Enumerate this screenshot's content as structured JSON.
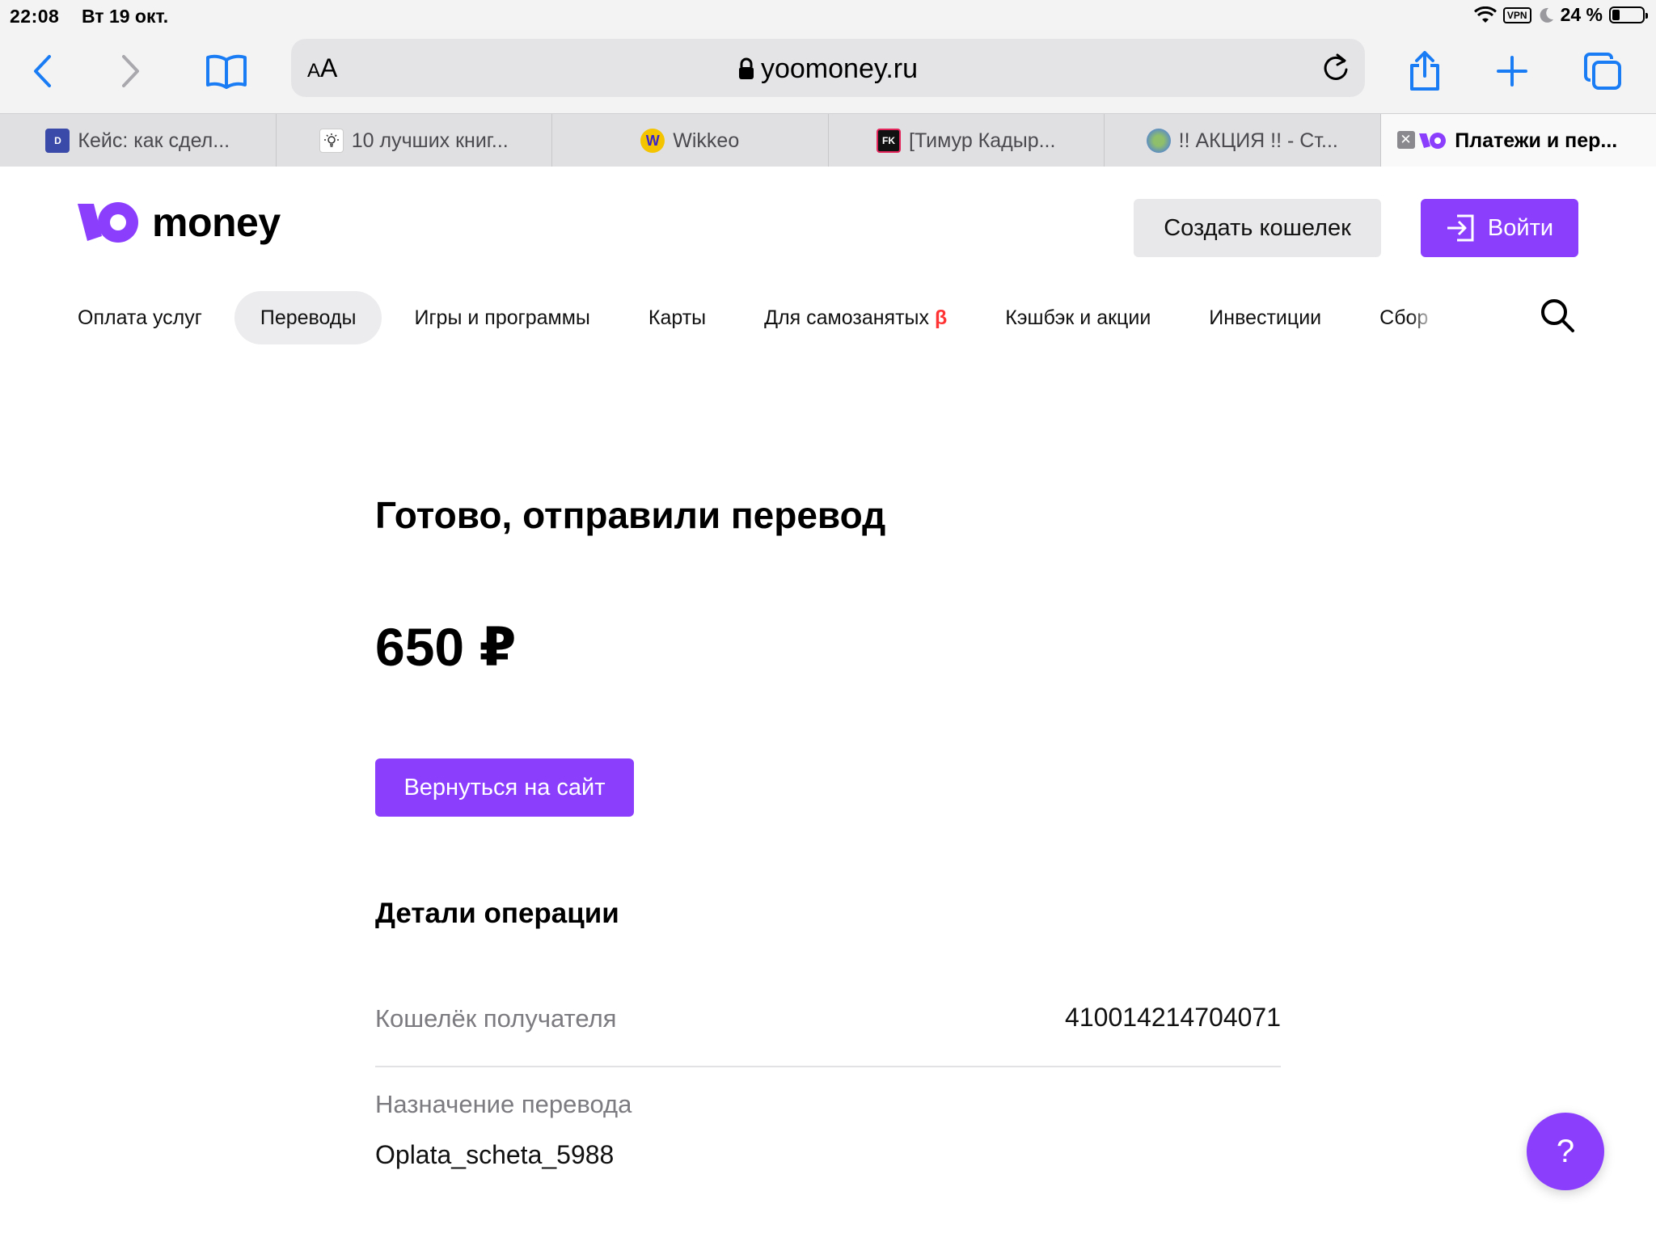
{
  "status_bar": {
    "time": "22:08",
    "date": "Вт 19 окт.",
    "vpn": "VPN",
    "battery_pct": "24 %",
    "battery_level": 0.24
  },
  "browser": {
    "url": "yoomoney.ru",
    "text_size_label": "AA",
    "icons": [
      "back-chevron-icon",
      "forward-chevron-icon",
      "bookmarks-book-icon",
      "lock-icon",
      "reload-icon",
      "share-icon",
      "plus-icon",
      "tabs-overview-icon"
    ],
    "tabs": [
      {
        "label": "Кейс: как сдел...",
        "favicon": "D"
      },
      {
        "label": "10 лучших книг...",
        "favicon": "lightbulb"
      },
      {
        "label": "Wikkeo",
        "favicon": "W"
      },
      {
        "label": "[Тимур Кадыр...",
        "favicon": "FK"
      },
      {
        "label": "!! АКЦИЯ !! - Ст...",
        "favicon": "globe"
      },
      {
        "label": "Платежи и пер...",
        "favicon": "yoomoney",
        "active": true
      }
    ]
  },
  "header": {
    "logo_text": "money",
    "create_wallet": "Создать кошелек",
    "login": "Войти"
  },
  "nav": {
    "items": [
      "Оплата услуг",
      "Переводы",
      "Игры и программы",
      "Карты",
      "Для самозанятых",
      "Кэшбэк и акции",
      "Инвестиции",
      "Сбор"
    ],
    "active": "Переводы",
    "beta_mark": "β"
  },
  "main": {
    "title": "Готово, отправили перевод",
    "amount": "650 ₽",
    "back_button": "Вернуться на сайт",
    "details_title": "Детали операции",
    "details": [
      {
        "label": "Кошелёк получателя",
        "value": "410014214704071"
      },
      {
        "label": "Назначение перевода",
        "value": "Oplata_scheta_5988"
      }
    ]
  },
  "help_button": "?",
  "colors": {
    "brand": "#8b3ffd",
    "beta": "#ff3333",
    "safari_blue": "#1a7cf5"
  }
}
